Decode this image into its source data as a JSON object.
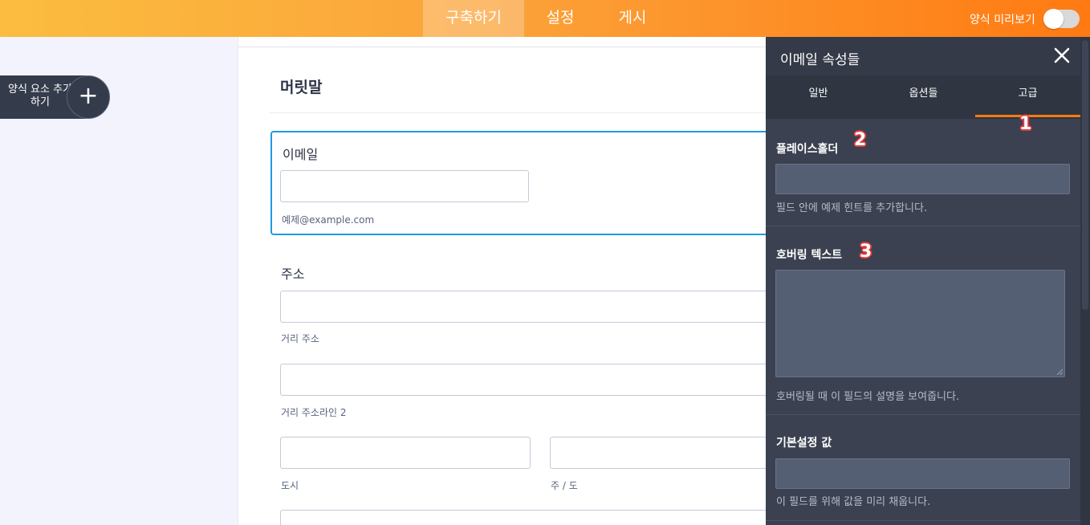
{
  "topbar": {
    "tabs": [
      {
        "label": "구축하기",
        "active": true
      },
      {
        "label": "설정",
        "active": false
      },
      {
        "label": "게시",
        "active": false
      }
    ],
    "preview_label": "양식 미리보기",
    "preview_enabled": false
  },
  "sidebar": {
    "add_element_label": "양식 요소 추가하기",
    "add_icon": "plus-icon"
  },
  "form": {
    "heading": "머릿말",
    "email": {
      "label": "이메일",
      "value": "",
      "sublabel": "예제@example.com"
    },
    "address": {
      "label": "주소",
      "street_sublabel": "거리 주소",
      "street2_sublabel": "거리 주소라인 2",
      "city_sublabel": "도시",
      "state_sublabel": "주 / 도"
    }
  },
  "panel": {
    "title": "이메일 속성들",
    "close_icon": "close-icon",
    "tabs": [
      {
        "label": "일반",
        "active": false
      },
      {
        "label": "옵션들",
        "active": false
      },
      {
        "label": "고급",
        "active": true
      }
    ],
    "placeholder": {
      "label": "플레이스홀더",
      "value": "",
      "help": "필드 안에 예제 힌트를 추가합니다."
    },
    "hover_text": {
      "label": "호버링 텍스트",
      "value": "",
      "help": "호버링될 때 이 필드의 설명을 보여줍니다."
    },
    "default_value": {
      "label": "기본설정 값",
      "value": "",
      "help": "이 필드를 위해 값을 미리 채웁니다."
    }
  },
  "annotations": {
    "badge_1": "1",
    "badge_2": "2",
    "badge_3": "3",
    "badge_color": "#e23b3b"
  },
  "colors": {
    "accent": "#ff7a12",
    "selection": "#1f9be0",
    "panel_bg": "#3b4150"
  }
}
